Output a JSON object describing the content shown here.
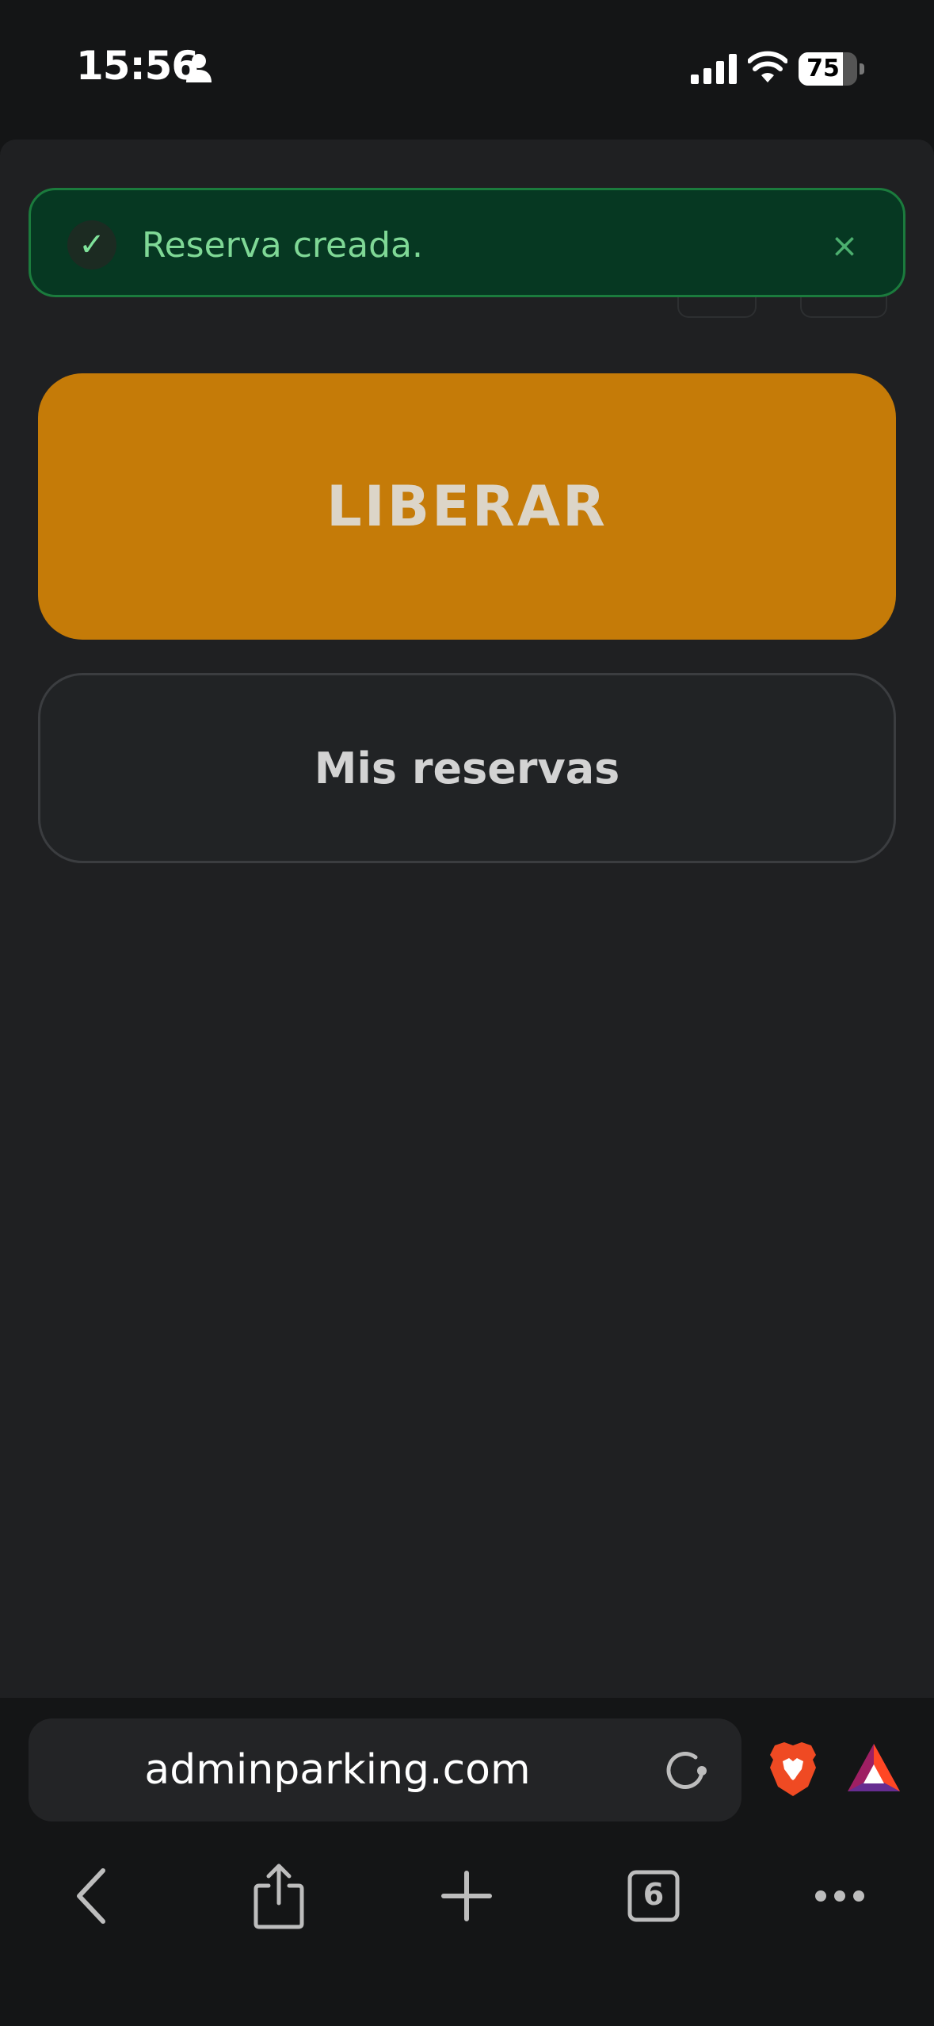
{
  "status_bar": {
    "time": "15:56",
    "battery_percent": "75",
    "battery_level": 0.75,
    "icons": [
      "person-icon",
      "signal-icon",
      "wifi-icon",
      "battery-icon"
    ]
  },
  "toast": {
    "message": "Reserva creada.",
    "check_glyph": "✓",
    "close_glyph": "×",
    "icons": [
      "check-icon",
      "close-icon"
    ]
  },
  "main": {
    "primary_button_label": "LIBERAR",
    "secondary_button_label": "Mis reservas",
    "colors": {
      "primary_button": "#c57b08",
      "toast_background": "#063822",
      "toast_text": "#7fd896"
    }
  },
  "browser": {
    "url": "adminparking.com",
    "tabs_count": "6",
    "icons": [
      "reload-icon",
      "brave-shields-icon",
      "bat-rewards-icon",
      "back-icon",
      "share-icon",
      "new-tab-icon",
      "tabs-icon",
      "more-icon"
    ]
  }
}
